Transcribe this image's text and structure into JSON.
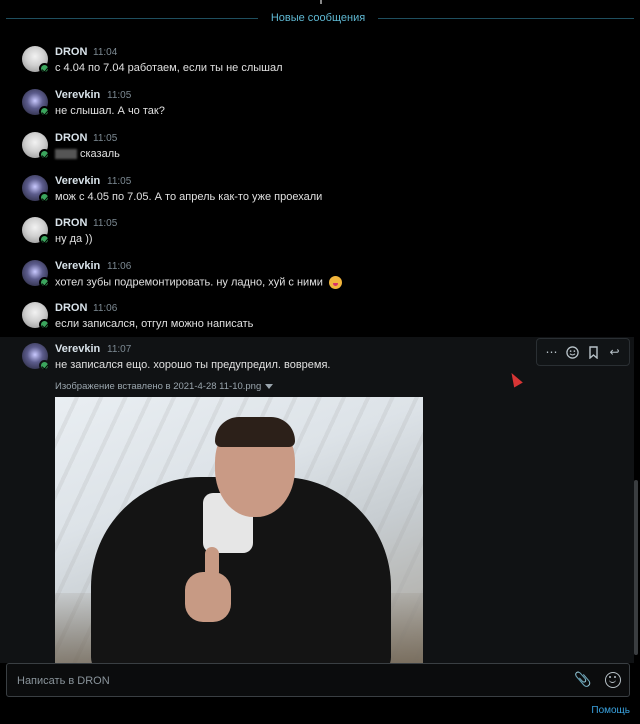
{
  "divider": {
    "label": "Новые сообщения"
  },
  "messages": [
    {
      "author": "DRON",
      "time": "11:04",
      "text": "с 4.04 по 7.04 работаем, если ты не слышал"
    },
    {
      "author": "Verevkin",
      "time": "11:05",
      "text": "не слышал. А чо так?"
    },
    {
      "author": "DRON",
      "time": "11:05",
      "text": "сказаль"
    },
    {
      "author": "Verevkin",
      "time": "11:05",
      "text": "мож с 4.05 по 7.05. А то апрель как-то уже проехали"
    },
    {
      "author": "DRON",
      "time": "11:05",
      "text": "ну да ))"
    },
    {
      "author": "Verevkin",
      "time": "11:06",
      "text": "хотел зубы подремонтировать. ну ладно, хуй с ними"
    },
    {
      "author": "DRON",
      "time": "11:06",
      "text": "если записался, отгул можно написать"
    },
    {
      "author": "Verevkin",
      "time": "11:07",
      "text": "не записался ещо. хорошо ты предупредил. вовремя.",
      "attachment": "Изображение вставлено в 2021-4-28 11-10.png"
    }
  ],
  "toolbar": {
    "icons": [
      "more-icon",
      "reaction-icon",
      "bookmark-icon",
      "reply-icon"
    ],
    "glyphs": {
      "more": "⋯",
      "reply": "↩"
    }
  },
  "composer": {
    "placeholder": "Написать в DRON",
    "clip_glyph": "📎"
  },
  "footer": {
    "help": "Помощь"
  },
  "colors": {
    "online": "#3ba55d",
    "accent": "#5fb8d2",
    "link": "#3aa3e0"
  }
}
